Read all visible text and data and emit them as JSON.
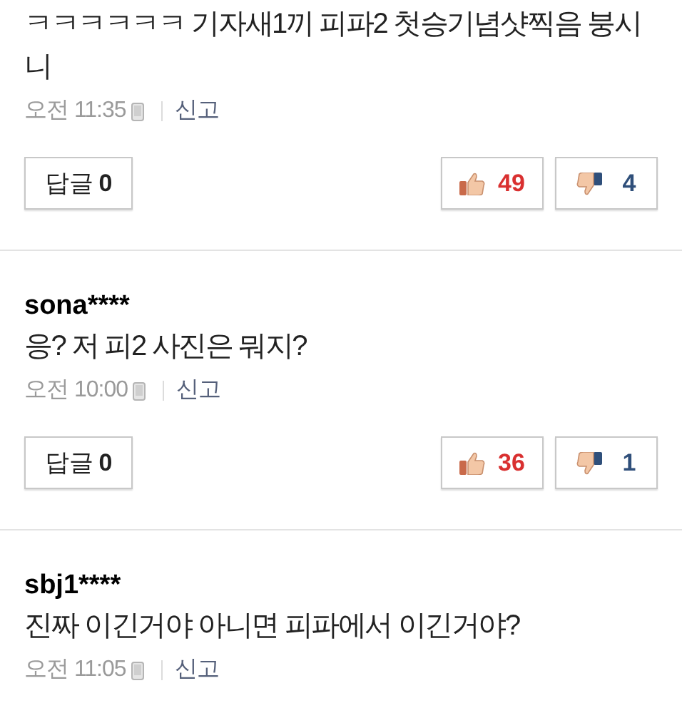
{
  "comments": [
    {
      "text": "ㅋㅋㅋㅋㅋㅋ 기자새1끼 피파2 첫승기념샷찍음 붕시니",
      "time": "오전 11:35",
      "report": "신고",
      "reply_label": "답글",
      "reply_count": "0",
      "likes": "49",
      "dislikes": "4"
    },
    {
      "author": "sona****",
      "text": "응? 저 피2 사진은 뭐지?",
      "time": "오전 10:00",
      "report": "신고",
      "reply_label": "답글",
      "reply_count": "0",
      "likes": "36",
      "dislikes": "1"
    },
    {
      "author": "sbj1****",
      "text": "진짜 이긴거야 아니면 피파에서 이긴거야?",
      "time": "오전 11:05",
      "report": "신고"
    }
  ]
}
